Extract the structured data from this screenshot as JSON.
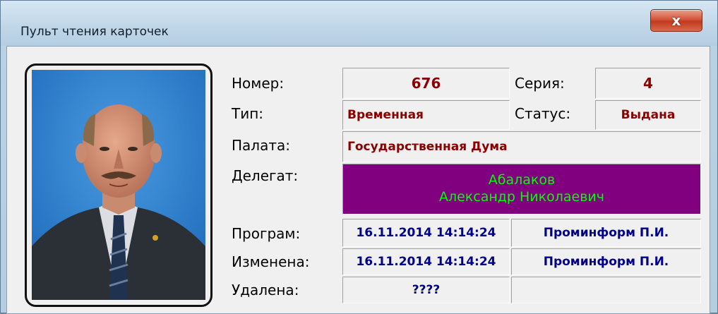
{
  "window": {
    "title": "Пульт чтения карточек",
    "close_label": "x"
  },
  "labels": {
    "number": "Номер:",
    "series": "Серия:",
    "type": "Тип:",
    "status": "Статус:",
    "chamber": "Палата:",
    "delegate": "Делегат:",
    "programmed": "Програм:",
    "changed": "Изменена:",
    "deleted": "Удалена:"
  },
  "card": {
    "number": "676",
    "series": "4",
    "type": "Временная",
    "status": "Выдана",
    "chamber": "Государственная Дума",
    "delegate_last_name": "Абалаков",
    "delegate_first_names": "Александр Николаевич",
    "programmed_at": "16.11.2014 14:14:24",
    "programmed_by": "Проминформ П.И.",
    "changed_at": "16.11.2014 14:14:24",
    "changed_by": "Проминформ П.И.",
    "deleted_at": "????",
    "deleted_by": ""
  },
  "colors": {
    "value_red": "#8b0000",
    "value_blue": "#00008b",
    "delegate_bg": "#800080",
    "delegate_text": "#00ff00"
  }
}
